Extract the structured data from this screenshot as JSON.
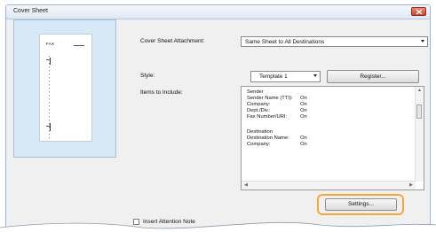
{
  "window": {
    "title": "Cover Sheet"
  },
  "preview": {
    "fax_label": "FAX"
  },
  "form": {
    "attachment_label": "Cover Sheet Attachment:",
    "attachment_value": "Same Sheet to All Destinations",
    "style_label": "Style:",
    "style_value": "Template 1",
    "register_button": "Register...",
    "items_label": "Items to Include:"
  },
  "items": [
    {
      "name": "Sender",
      "value": ""
    },
    {
      "name": "Sender Name (TTI):",
      "value": "On"
    },
    {
      "name": "Company:",
      "value": "On"
    },
    {
      "name": "Dept./Div.:",
      "value": "On"
    },
    {
      "name": "Fax Number/URI:",
      "value": "On"
    },
    {
      "name": "",
      "value": ""
    },
    {
      "name": "Destination",
      "value": ""
    },
    {
      "name": "Destination Name:",
      "value": "On"
    },
    {
      "name": "Company:",
      "value": "On"
    }
  ],
  "settings_button": "Settings...",
  "attention_note_label": "Insert Attention Note"
}
